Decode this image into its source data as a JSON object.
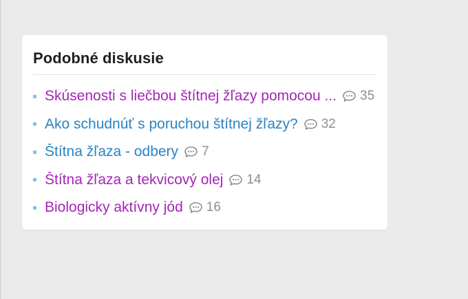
{
  "similar_discussions": {
    "title": "Podobné diskusie",
    "items": [
      {
        "label": "Skúsenosti s liečbou štítnej žľazy pomocou ...",
        "comment_count": "35",
        "visited": true
      },
      {
        "label": "Ako schudnúť s poruchou štítnej žľazy?",
        "comment_count": "32",
        "visited": false
      },
      {
        "label": "Štítna žľaza - odbery",
        "comment_count": "7",
        "visited": false
      },
      {
        "label": "Štítna žľaza a tekvicový olej",
        "comment_count": "14",
        "visited": true
      },
      {
        "label": "Biologicky aktívny jód",
        "comment_count": "16",
        "visited": true
      }
    ]
  },
  "icons": {
    "comment": "speech-bubble-icon",
    "bullet": "square-bullet"
  },
  "colors": {
    "background": "#ebebeb",
    "card": "#ffffff",
    "title": "#1f1f1f",
    "link_visited": "#a524b8",
    "link_unvisited": "#2a83c3",
    "bullet": "#7ec3e6",
    "comment_count": "#8e8e8e",
    "divider": "#e3e3e3"
  }
}
